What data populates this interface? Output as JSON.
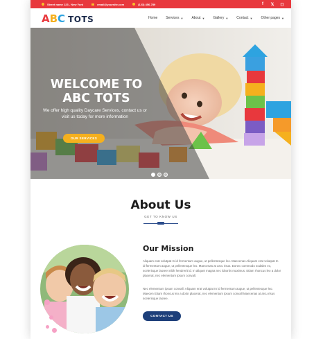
{
  "topbar": {
    "address": "Street name 123 - New York",
    "email": "email@yoursite.com",
    "phone": "(123) 456-789",
    "social_icons": [
      "facebook-icon",
      "twitter-icon",
      "instagram-icon"
    ]
  },
  "logo": {
    "letters": [
      "A",
      "B",
      "C"
    ],
    "letter_colors": [
      "#e8383d",
      "#f5b01e",
      "#2ea3e0"
    ],
    "word": "TOTS"
  },
  "nav": {
    "items": [
      {
        "label": "Home",
        "has_caret": false
      },
      {
        "label": "Services",
        "has_caret": true
      },
      {
        "label": "About",
        "has_caret": true
      },
      {
        "label": "Gallery",
        "has_caret": true
      },
      {
        "label": "Contact",
        "has_caret": true
      },
      {
        "label": "Other pages",
        "has_caret": true
      }
    ]
  },
  "hero": {
    "title_line1": "WELCOME TO",
    "title_line2": "ABC TOTS",
    "text": "We offer high quality Daycare Services, contact us or visit us today for more information",
    "button": "OUR SERVICES",
    "slides": 3,
    "active_slide": 1
  },
  "about": {
    "title": "About Us",
    "subtitle": "GET TO KNOW US"
  },
  "mission": {
    "title": "Our Mission",
    "para1": "Aliquam erat volutpat In id fermentum augue, ut pellentesque leo. Maecenas Aliquam erat volutpat In id fermentum augue, ut pellentesque leo. Maecenas at arcu risus. Donec commodo sodales ex, scelerisque laoreet nibh hendrerit id. In aliquet magna nec lobortis maximus. Etiam rhoncus leo a dolor placerat, nec elementum ipsum convall.",
    "para2": "Nec elementum ipsum convall. Aliquam erat volutpat In id fermentum augue, ut pellentesque leo. Maecen Etiam rhoncus leo a dolor placerat, nec elementum ipsum convall Maecenas at arcu risus scelerisque laoree.",
    "button": "CONTACT US"
  },
  "colors": {
    "brand_red": "#e8383d",
    "brand_yellow": "#f5b01e",
    "brand_navy": "#1d3f7a"
  }
}
